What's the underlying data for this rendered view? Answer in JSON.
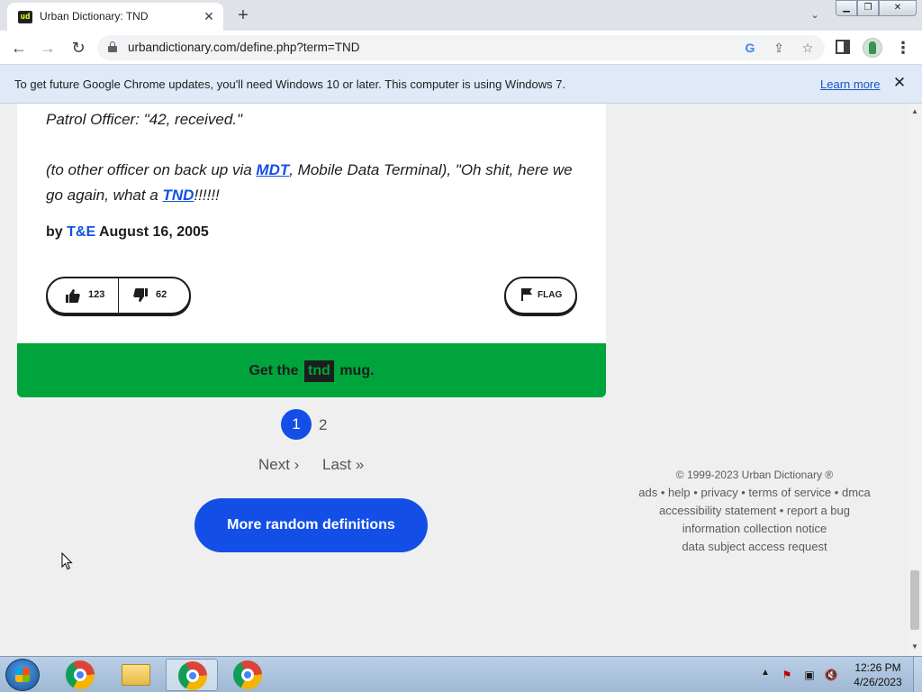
{
  "browser": {
    "tab_title": "Urban Dictionary: TND",
    "tab_favicon_text": "ud",
    "url": "urbandictionary.com/define.php?term=TND",
    "window_controls": {
      "minimize": "▁",
      "maximize": "❐",
      "close": "✕"
    }
  },
  "infobar": {
    "message": "To get future Google Chrome updates, you'll need Windows 10 or later. This computer is using Windows 7.",
    "learn_more": "Learn more"
  },
  "definition": {
    "line1": "Patrol Officer: \"42, received.\"",
    "line2_prefix": "(to other officer on back up via ",
    "line2_link1": "MDT",
    "line2_mid": ", Mobile Data Terminal), \"Oh shit, here we go again, what a ",
    "line2_link2": "TND",
    "line2_suffix": "!!!!!!",
    "by_label": "by ",
    "author": "T&E",
    "date": " August 16, 2005",
    "upvotes": "123",
    "downvotes": "62",
    "flag_label": "FLAG"
  },
  "mug_banner": {
    "prefix": "Get the ",
    "word": "tnd",
    "suffix": " mug."
  },
  "pagination": {
    "current_page": "1",
    "other_page": "2",
    "next": "Next ›",
    "last": "Last »"
  },
  "random_button": "More random definitions",
  "footer": {
    "copyright": "© 1999-2023 Urban Dictionary ®",
    "links_row1": [
      "ads",
      "help",
      "privacy",
      "terms of service",
      "dmca"
    ],
    "links_row2": [
      "accessibility statement",
      "report a bug"
    ],
    "link_row3": "information collection notice",
    "link_row4": "data subject access request",
    "separator": "•"
  },
  "taskbar": {
    "time": "12:26 PM",
    "date": "4/26/2023"
  },
  "colors": {
    "accent_blue": "#134fe6",
    "banner_green": "#00a43c",
    "infobar_bg": "#dfe9f7"
  },
  "icons": [
    "search-icon",
    "lock-icon",
    "google-icon",
    "share-icon",
    "star-icon",
    "thumbs-up-icon",
    "thumbs-down-icon",
    "flag-icon",
    "chrome-icon",
    "folder-icon"
  ]
}
